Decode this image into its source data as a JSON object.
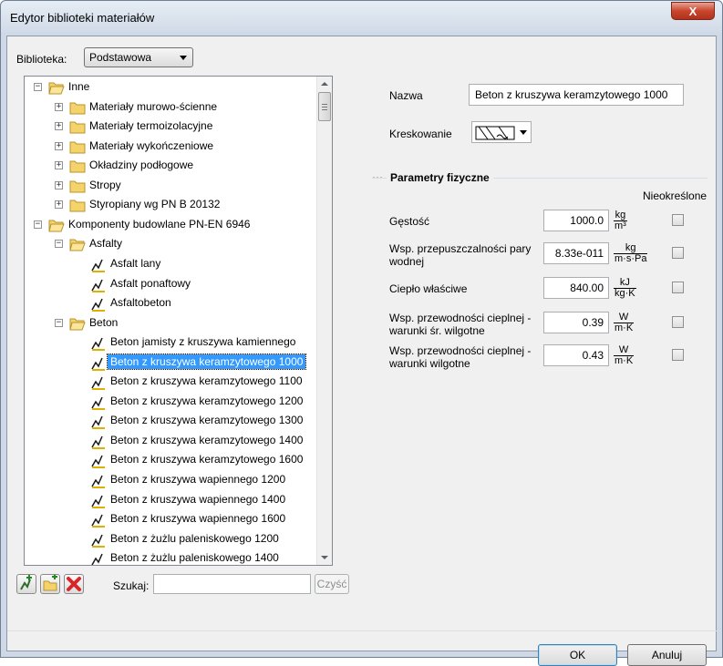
{
  "window": {
    "title": "Edytor biblioteki materiałów",
    "close_label": "X"
  },
  "library": {
    "label": "Biblioteka:",
    "selected": "Podstawowa"
  },
  "tree": {
    "items": [
      {
        "label": "Inne",
        "type": "folder-open",
        "expander": "−"
      },
      {
        "label": "Materiały murowo-ścienne",
        "type": "folder",
        "expander": "+"
      },
      {
        "label": "Materiały termoizolacyjne",
        "type": "folder",
        "expander": "+"
      },
      {
        "label": "Materiały wykończeniowe",
        "type": "folder",
        "expander": "+"
      },
      {
        "label": "Okładziny podłogowe",
        "type": "folder",
        "expander": "+"
      },
      {
        "label": "Stropy",
        "type": "folder",
        "expander": "+"
      },
      {
        "label": "Styropiany wg PN B 20132",
        "type": "folder",
        "expander": "+"
      },
      {
        "label": "Komponenty budowlane PN-EN 6946",
        "type": "folder-open",
        "expander": "−"
      },
      {
        "label": "Asfalty",
        "type": "folder-open",
        "expander": "−"
      },
      {
        "label": "Asfalt lany",
        "type": "material"
      },
      {
        "label": "Asfalt ponaftowy",
        "type": "material"
      },
      {
        "label": "Asfaltobeton",
        "type": "material"
      },
      {
        "label": "Beton",
        "type": "folder-open",
        "expander": "−"
      },
      {
        "label": "Beton jamisty z kruszywa kamiennego",
        "type": "material"
      },
      {
        "label": "Beton z kruszywa keramzytowego 1000",
        "type": "material",
        "selected": true
      },
      {
        "label": "Beton z kruszywa keramzytowego 1100",
        "type": "material"
      },
      {
        "label": "Beton z kruszywa keramzytowego 1200",
        "type": "material"
      },
      {
        "label": "Beton z kruszywa keramzytowego 1300",
        "type": "material"
      },
      {
        "label": "Beton z kruszywa keramzytowego 1400",
        "type": "material"
      },
      {
        "label": "Beton z kruszywa keramzytowego 1600",
        "type": "material"
      },
      {
        "label": "Beton z kruszywa wapiennego 1200",
        "type": "material"
      },
      {
        "label": "Beton z kruszywa wapiennego 1400",
        "type": "material"
      },
      {
        "label": "Beton z kruszywa wapiennego 1600",
        "type": "material"
      },
      {
        "label": "Beton z żużlu paleniskowego 1200",
        "type": "material"
      },
      {
        "label": "Beton z żużlu paleniskowego 1400",
        "type": "material"
      }
    ]
  },
  "toolbar": {
    "search_label": "Szukaj:",
    "search_value": "",
    "clear_label": "Czyść"
  },
  "properties": {
    "name_label": "Nazwa",
    "name_value": "Beton z kruszywa keramzytowego 1000",
    "hatch_label": "Kreskowanie",
    "group_title": "Parametry fizyczne",
    "group_dots": "···",
    "undefined_header": "Nieokreślone",
    "params": [
      {
        "label": "Gęstość",
        "value": "1000.0",
        "unit_num": "kg",
        "unit_den": "m³",
        "checked": false
      },
      {
        "label": "Wsp. przepuszczalności pary wodnej",
        "value": "8.33e-011",
        "unit_num": "kg",
        "unit_den": "m·s·Pa",
        "checked": false
      },
      {
        "label": "Ciepło właściwe",
        "value": "840.00",
        "unit_num": "kJ",
        "unit_den": "kg·K",
        "checked": false
      },
      {
        "label": "Wsp. przewodności cieplnej - warunki śr. wilgotne",
        "value": "0.39",
        "unit_num": "W",
        "unit_den": "m·K",
        "checked": false
      },
      {
        "label": "Wsp. przewodności cieplnej - warunki wilgotne",
        "value": "0.43",
        "unit_num": "W",
        "unit_den": "m·K",
        "checked": false
      }
    ]
  },
  "buttons": {
    "ok": "OK",
    "cancel": "Anuluj"
  },
  "colors": {
    "selection": "#3399ff",
    "folder": "#f5d36b",
    "delete": "#d9262b"
  }
}
